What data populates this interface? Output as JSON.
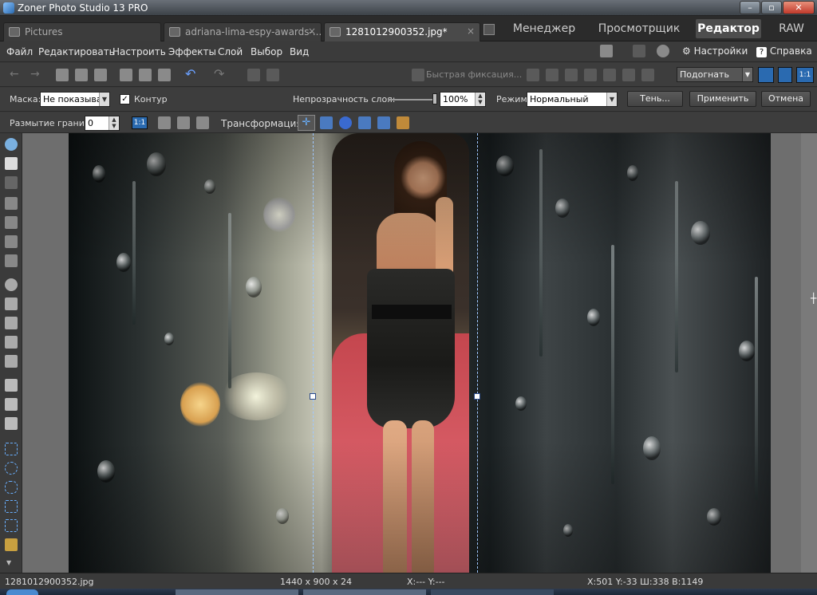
{
  "window": {
    "title": "Zoner Photo Studio 13 PRO"
  },
  "tabs": [
    {
      "label": "Pictures"
    },
    {
      "label": "adriana-lima-espy-awards-..."
    },
    {
      "label": "1281012900352.jpg*"
    }
  ],
  "modes": [
    {
      "label": "Менеджер"
    },
    {
      "label": "Просмотрщик"
    },
    {
      "label": "Редактор"
    },
    {
      "label": "RAW"
    }
  ],
  "menu": [
    "Файл",
    "Редактировать",
    "Настроить",
    "Эффекты",
    "Слой",
    "Выбор",
    "Вид"
  ],
  "menu_right": {
    "settings": "Настройки",
    "help": "Справка"
  },
  "toolbar": {
    "quick_fix": "Быстрая фиксация...",
    "zoom_mode": "Подогнать",
    "zoom_100": "1:1"
  },
  "options": {
    "mask_label": "Маска:",
    "mask_value": "Не показыват",
    "contour_label": "Контур",
    "contour_checked": true,
    "opacity_label": "Непрозрачность слоя:",
    "opacity_value": "100%",
    "opacity_level": 1.0,
    "mode_label": "Режим:",
    "mode_value": "Нормальный",
    "shadow_btn": "Тень...",
    "apply_btn": "Применить",
    "cancel_btn": "Отмена"
  },
  "options2": {
    "blur_label": "Размытие границ:",
    "blur_value": "0",
    "zoom_11": "1:1",
    "transform_label": "Трансформация:"
  },
  "status": {
    "filename": "1281012900352.jpg",
    "dimensions": "1440 x 900 x 24",
    "cursor": "X:---  Y:---",
    "selection": "X:501  Y:-33  Ш:338  В:1149"
  },
  "icons": [
    "zoom-icon",
    "hand-icon",
    "crop-icon",
    "straighten-icon",
    "clone-icon",
    "brush-icon",
    "eraser-icon",
    "rect-select-icon",
    "ellipse-select-icon",
    "lasso-icon",
    "magic-wand-icon"
  ],
  "colors": {
    "accent": "#4d4d4d",
    "guide": "#a0c8ff"
  }
}
